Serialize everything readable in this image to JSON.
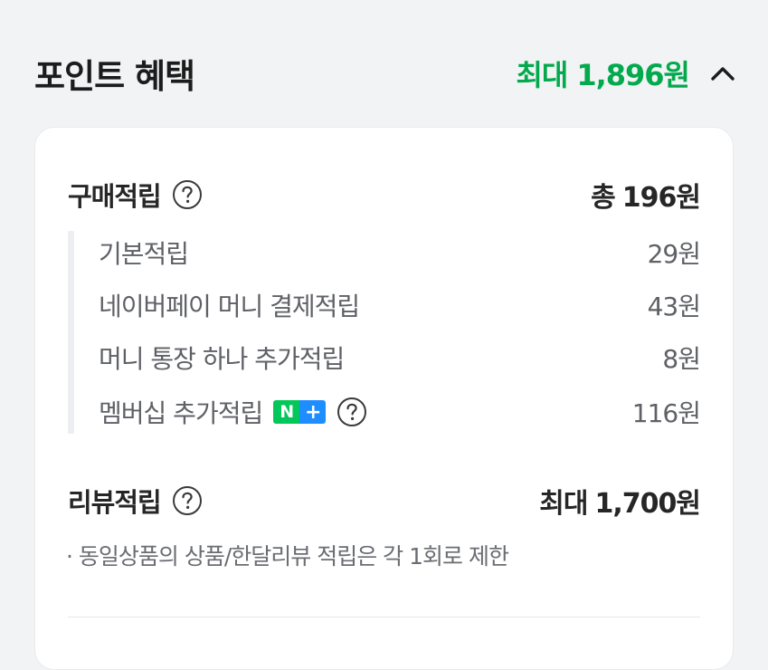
{
  "header": {
    "title": "포인트 혜택",
    "max_prefix": "최대",
    "max_amount": "1,896원",
    "toggle_icon": "chevron-up-icon",
    "accent_color": "#03a94d"
  },
  "purchase": {
    "label": "구매적립",
    "total_prefix": "총",
    "total_amount": "196원",
    "items": [
      {
        "label": "기본적립",
        "value": "29원"
      },
      {
        "label": "네이버페이 머니 결제적립",
        "value": "43원"
      },
      {
        "label": "머니 통장 하나 추가적립",
        "value": "8원"
      },
      {
        "label": "멤버십 추가적립",
        "value": "116원",
        "badge_n": "N",
        "badge_plus": "+"
      }
    ]
  },
  "review": {
    "label": "리뷰적립",
    "max_prefix": "최대",
    "max_amount": "1,700원",
    "notice": "· 동일상품의 상품/한달리뷰 적립은 각 1회로 제한"
  }
}
